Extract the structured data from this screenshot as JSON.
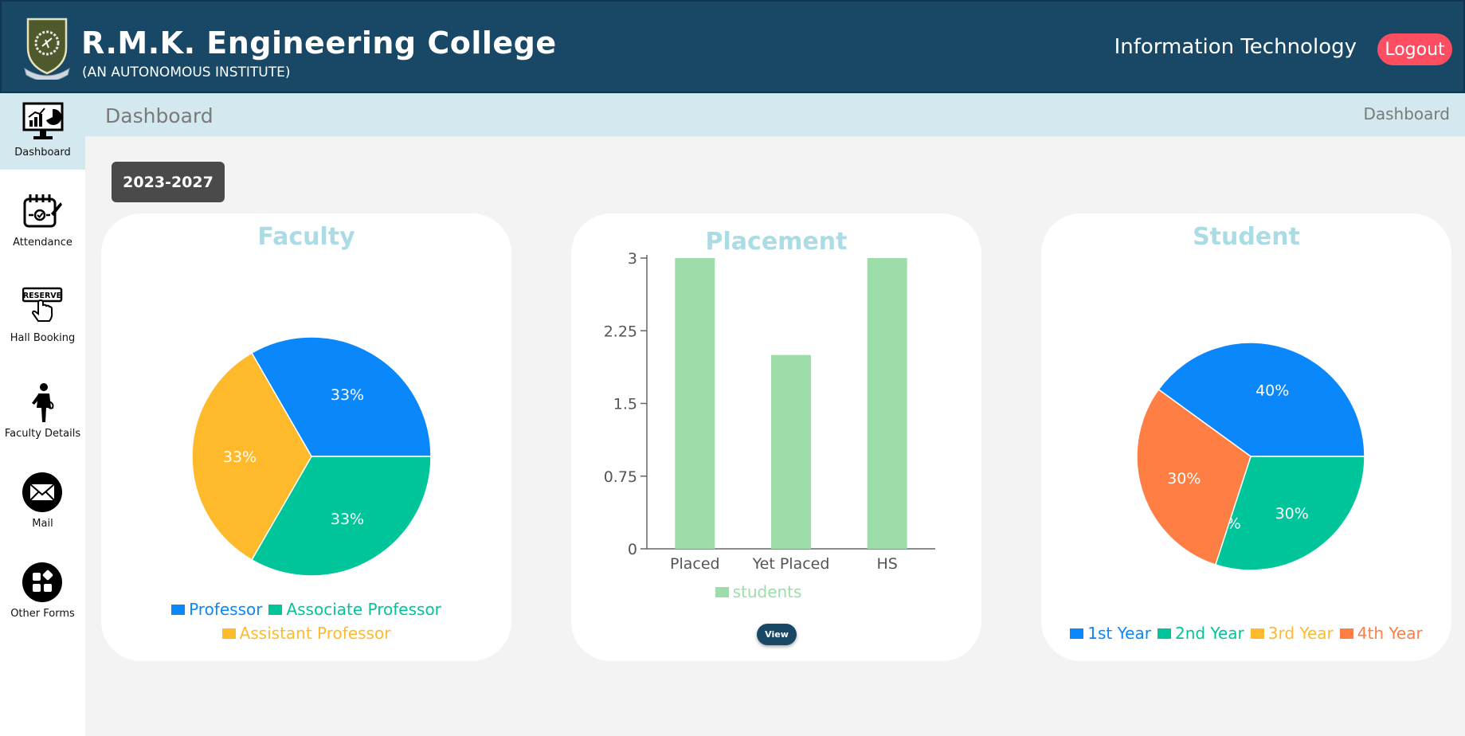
{
  "header": {
    "college_name": "R.M.K. Engineering College",
    "subtitle": "(AN AUTONOMOUS INSTITUTE)",
    "department": "Information Technology",
    "logout_label": "Logout"
  },
  "sidebar": {
    "items": [
      {
        "label": "Dashboard",
        "icon": "monitor-chart-icon",
        "active": true
      },
      {
        "label": "Attendance",
        "icon": "calendar-check-icon"
      },
      {
        "label": "Hall Booking",
        "icon": "reserve-hand-icon"
      },
      {
        "label": "Faculty Details",
        "icon": "person-icon"
      },
      {
        "label": "Mail",
        "icon": "envelope-icon"
      },
      {
        "label": "Other Forms",
        "icon": "grid-icon"
      }
    ]
  },
  "breadcrumb": {
    "title": "Dashboard",
    "current": "Dashboard"
  },
  "year_selector": {
    "label": "2023-2027"
  },
  "cards": {
    "faculty_title": "Faculty",
    "placement_title": "Placement",
    "student_title": "Student",
    "view_label": "View"
  },
  "colors": {
    "blue": "#0a88fb",
    "green": "#00c59b",
    "yellow": "#ffba2b",
    "orange": "#ff7e44",
    "bar": "#9dddaa"
  },
  "chart_data": [
    {
      "type": "pie",
      "title": "Faculty",
      "labels": [
        "Professor",
        "Associate Professor",
        "Assistant Professor"
      ],
      "values": [
        33,
        33,
        33
      ],
      "value_labels": [
        "33%",
        "33%",
        "33%"
      ],
      "colors": [
        "#0a88fb",
        "#00c59b",
        "#ffba2b"
      ]
    },
    {
      "type": "bar",
      "title": "Placement",
      "categories": [
        "Placed",
        "Yet Placed",
        "HS"
      ],
      "series": [
        {
          "name": "students",
          "values": [
            3,
            2,
            3
          ]
        }
      ],
      "ylim": [
        0,
        3
      ],
      "yticks": [
        "0",
        "0.75",
        "1.5",
        "2.25",
        "3"
      ]
    },
    {
      "type": "pie",
      "title": "Student",
      "labels": [
        "1st Year",
        "2nd Year",
        "3rd Year",
        "4th Year"
      ],
      "values": [
        40,
        30,
        0,
        30
      ],
      "value_labels": [
        "40%",
        "30%",
        "0%",
        "30%"
      ],
      "colors": [
        "#0a88fb",
        "#00c59b",
        "#ffba2b",
        "#ff7e44"
      ]
    }
  ]
}
